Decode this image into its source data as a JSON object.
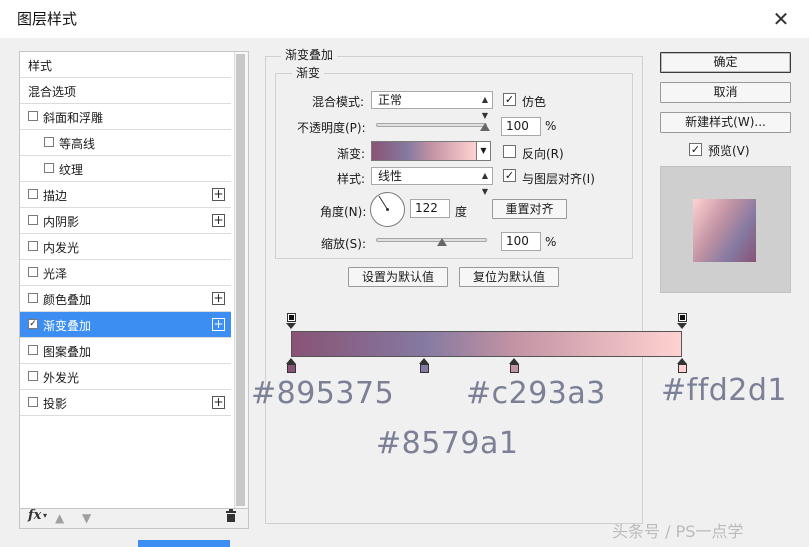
{
  "window": {
    "title": "图层样式",
    "close_icon": "close-icon"
  },
  "sidebar": {
    "items": [
      {
        "label": "样式",
        "checkbox": false,
        "plus": false,
        "checked": false,
        "selected": false
      },
      {
        "label": "混合选项",
        "checkbox": false,
        "plus": false,
        "checked": false,
        "selected": false
      },
      {
        "label": "斜面和浮雕",
        "checkbox": true,
        "plus": false,
        "checked": false,
        "selected": false
      },
      {
        "label": "等高线",
        "checkbox": true,
        "plus": false,
        "checked": false,
        "selected": false
      },
      {
        "label": "纹理",
        "checkbox": true,
        "plus": false,
        "checked": false,
        "selected": false
      },
      {
        "label": "描边",
        "checkbox": true,
        "plus": true,
        "checked": false,
        "selected": false
      },
      {
        "label": "内阴影",
        "checkbox": true,
        "plus": true,
        "checked": false,
        "selected": false
      },
      {
        "label": "内发光",
        "checkbox": true,
        "plus": false,
        "checked": false,
        "selected": false
      },
      {
        "label": "光泽",
        "checkbox": true,
        "plus": false,
        "checked": false,
        "selected": false
      },
      {
        "label": "颜色叠加",
        "checkbox": true,
        "plus": true,
        "checked": false,
        "selected": false
      },
      {
        "label": "渐变叠加",
        "checkbox": true,
        "plus": true,
        "checked": true,
        "selected": true
      },
      {
        "label": "图案叠加",
        "checkbox": true,
        "plus": false,
        "checked": false,
        "selected": false
      },
      {
        "label": "外发光",
        "checkbox": true,
        "plus": false,
        "checked": false,
        "selected": false
      },
      {
        "label": "投影",
        "checkbox": true,
        "plus": true,
        "checked": false,
        "selected": false
      }
    ],
    "footer": {
      "fx_label": "fx",
      "up_icon": "arrow-up-icon",
      "down_icon": "arrow-down-icon",
      "trash_icon": "trash-icon"
    }
  },
  "panel": {
    "group_title": "渐变叠加",
    "subgroup_title": "渐变",
    "blend_mode_label": "混合模式:",
    "blend_mode_value": "正常",
    "dither_label": "仿色",
    "dither_checked": true,
    "opacity_label": "不透明度(P):",
    "opacity_value": "100",
    "opacity_unit": "%",
    "gradient_label": "渐变:",
    "reverse_label": "反向(R)",
    "reverse_checked": false,
    "style_label": "样式:",
    "style_value": "线性",
    "align_label": "与图层对齐(I)",
    "align_checked": true,
    "angle_label": "角度(N):",
    "angle_value": "122",
    "angle_unit": "度",
    "reset_align_button": "重置对齐",
    "scale_label": "缩放(S):",
    "scale_value": "100",
    "scale_unit": "%",
    "set_default_button": "设置为默认值",
    "reset_default_button": "复位为默认值"
  },
  "actions": {
    "ok_button": "确定",
    "cancel_button": "取消",
    "new_style_button": "新建样式(W)...",
    "preview_label": "预览(V)",
    "preview_checked": true
  },
  "gradient_stops": {
    "colors": [
      "#895375",
      "#8579a1",
      "#c293a3",
      "#ffd2d1"
    ],
    "positions": [
      0.0,
      0.34,
      0.57,
      1.0
    ],
    "opacity_stops": [
      0.0,
      1.0
    ]
  },
  "annotations": {
    "hex1": "#895375",
    "hex2": "#c293a3",
    "hex3": "#ffd2d1",
    "hex4": "#8579a1"
  },
  "watermark": "头条号 / PS一点学",
  "colors": {
    "selection": "#3c8ef2",
    "annotation_text": "#7c8096"
  }
}
